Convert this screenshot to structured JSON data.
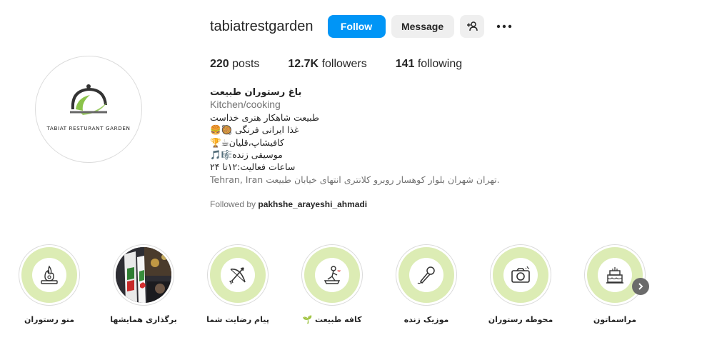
{
  "profile": {
    "username": "tabiatrestgarden",
    "avatar_text": "TABIAT RESTURANT GARDEN",
    "follow_label": "Follow",
    "message_label": "Message",
    "stats": [
      {
        "count": "220",
        "label": "posts"
      },
      {
        "count": "12.7K",
        "label": "followers"
      },
      {
        "count": "141",
        "label": "following"
      }
    ],
    "bio": {
      "name": "باغ رستوران طبیعت",
      "category": "Kitchen/cooking",
      "lines": [
        "طبیعت شاهکار هنری خداست",
        "غذا ایرانی فرنگی 🥘🍔",
        "کافیشاپ،قلیان☕🏆",
        "موسیقی زنده🎼🎵",
        "ساعات فعالیت:۱۲تا ۲۴"
      ],
      "address": "Tehran, Iran  تهران شهران بلوار کوهسار روبرو کلانتری انتهای خیابان طبیعت."
    },
    "followed_by_prefix": "Followed by",
    "followed_by_user": "pakhshe_arayeshi_ahmadi"
  },
  "highlights": [
    {
      "label": "منو رستوران",
      "icon": "menu-stove-icon",
      "kind": "icon"
    },
    {
      "label": "برگذاری همایشها",
      "icon": "event-photo",
      "kind": "photo"
    },
    {
      "label": "پیام رضایت شما",
      "icon": "bow-arrow-icon",
      "kind": "icon"
    },
    {
      "label": "کافه طبیعت 🌱",
      "icon": "cafe-person-icon",
      "kind": "icon"
    },
    {
      "label": "موزیک زنده",
      "icon": "microphone-icon",
      "kind": "icon"
    },
    {
      "label": "محوطه رستوران",
      "icon": "camera-icon",
      "kind": "icon"
    },
    {
      "label": "مراسماتون",
      "icon": "cake-icon",
      "kind": "icon"
    }
  ],
  "colors": {
    "follow_blue": "#0095f6",
    "highlight_green": "#dcecb4",
    "secondary_button": "#efefef"
  }
}
